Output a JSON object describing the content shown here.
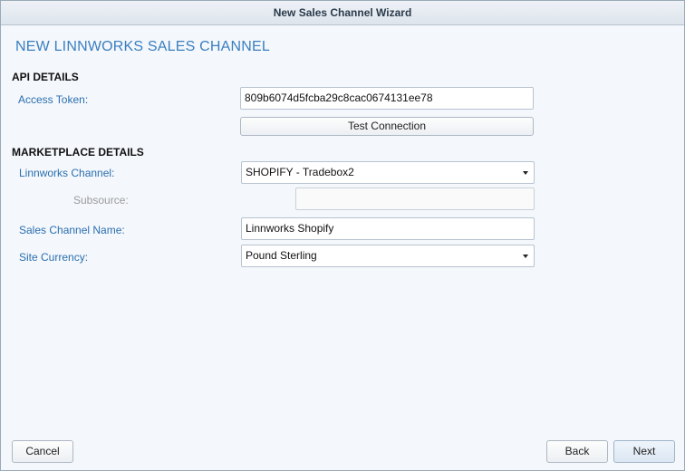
{
  "window": {
    "title": "New Sales Channel Wizard"
  },
  "wizard": {
    "heading": "NEW LINNWORKS SALES CHANNEL"
  },
  "api_details": {
    "section_title": "API DETAILS",
    "access_token_label": "Access Token:",
    "access_token_value": "809b6074d5fcba29c8cac0674131ee78",
    "test_connection_label": "Test Connection"
  },
  "marketplace_details": {
    "section_title": "MARKETPLACE DETAILS",
    "linnworks_channel_label": "Linnworks Channel:",
    "linnworks_channel_value": "SHOPIFY - Tradebox2",
    "subsource_label": "Subsource:",
    "subsource_value": "",
    "sales_channel_name_label": "Sales Channel Name:",
    "sales_channel_name_value": "Linnworks Shopify",
    "site_currency_label": "Site Currency:",
    "site_currency_value": "Pound Sterling"
  },
  "footer": {
    "cancel_label": "Cancel",
    "back_label": "Back",
    "next_label": "Next"
  },
  "colors": {
    "label_blue": "#2a6fb0",
    "heading_blue": "#3a7fc0",
    "background": "#f4f7fb"
  }
}
